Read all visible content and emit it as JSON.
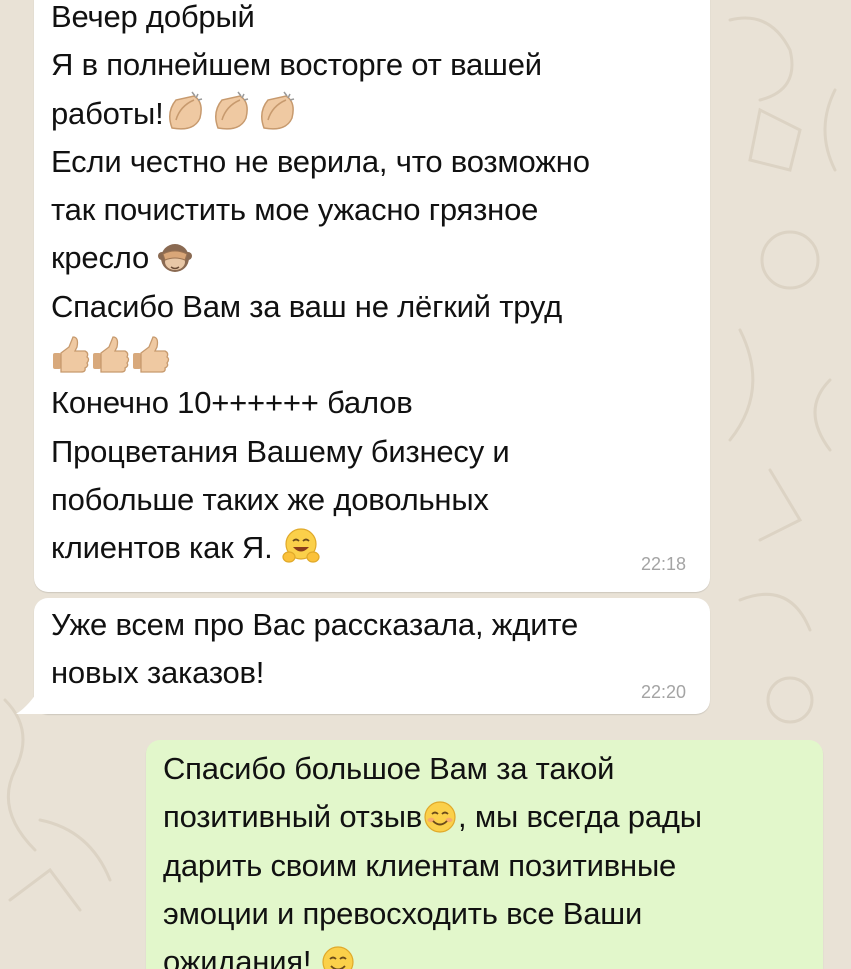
{
  "chat": {
    "messages": [
      {
        "direction": "incoming",
        "lines": [
          "Вечер добрый",
          "Я в полнейшем восторге от вашей",
          "работы!",
          "Если честно не верила, что возможно",
          "так почистить мое ужасно грязное",
          "кресло",
          "Спасибо Вам за ваш не лёгкий труд",
          "",
          "Конечно 10++++++ балов",
          "Процветания Вашему бизнесу и",
          "побольше таких же довольных",
          "клиентов как Я."
        ],
        "time": "22:18"
      },
      {
        "direction": "incoming",
        "lines": [
          "Уже всем про Вас рассказала, ждите",
          "новых заказов!"
        ],
        "time": "22:20"
      },
      {
        "direction": "outgoing",
        "lines": [
          "Спасибо большое Вам за такой",
          "позитивный отзыв",
          ", мы всегда рады",
          "дарить своим клиентам позитивные",
          "эмоции и превосходить все Ваши",
          "ожидания!"
        ]
      }
    ]
  },
  "emojis": {
    "clapping": "clapping-hands-icon",
    "see_no_evil": "see-no-evil-monkey-icon",
    "thumbs_up": "thumbs-up-icon",
    "hugging": "hugging-face-icon",
    "smiling": "smiling-face-icon"
  },
  "colors": {
    "wallpaper": "#e9e2d6",
    "incoming_bubble": "#ffffff",
    "outgoing_bubble": "#e2f7cb",
    "text": "#111111",
    "timestamp": "#a4a4a4"
  }
}
